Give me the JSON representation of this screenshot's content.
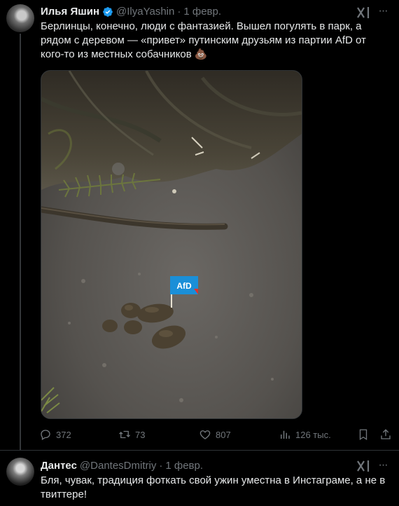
{
  "tweet1": {
    "author_name": "Илья Яшин",
    "handle": "@IlyaYashin",
    "separator": "·",
    "date": "1 февр.",
    "text": "Берлинцы, конечно, люди с фантазией. Вышел погулять в парк, а рядом с деревом — «привет» путинским друзьям из партии AfD от кого-то из местных собачников 💩",
    "flag_text": "AfD",
    "stats": {
      "replies": "372",
      "retweets": "73",
      "likes": "807",
      "views": "126 тыс."
    }
  },
  "tweet2": {
    "author_name": "Дантес",
    "handle": "@DantesDmitriy",
    "separator": "·",
    "date": "1 февр.",
    "text": "Бля, чувак, традиция фоткать свой ужин уместна в Инстаграме, а не в твиттере!"
  },
  "icons": {
    "verified": "verified-badge-icon",
    "grok": "grok-icon",
    "more": "more-icon",
    "reply": "reply-icon",
    "retweet": "retweet-icon",
    "like": "heart-icon",
    "views": "views-icon",
    "bookmark": "bookmark-icon",
    "share": "share-icon"
  },
  "colors": {
    "background": "#000000",
    "text": "#e7e9ea",
    "secondary": "#71767b",
    "verified": "#1d9bf0",
    "divider": "#2f3336",
    "flag": "#1a8fd8"
  }
}
